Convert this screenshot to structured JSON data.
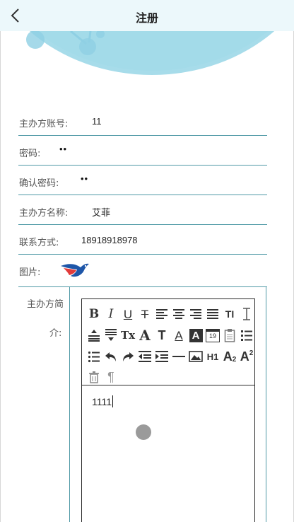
{
  "header": {
    "title": "注册",
    "back_icon": "chevron-left-icon"
  },
  "form": {
    "account": {
      "label": "主办方账号:",
      "value": "11"
    },
    "password": {
      "label": "密码:",
      "value": "••"
    },
    "confirm": {
      "label": "确认密码:",
      "value": "••"
    },
    "name": {
      "label": "主办方名称:",
      "value": "艾菲"
    },
    "contact": {
      "label": "联系方式:",
      "value": "18918918978"
    },
    "picture": {
      "label": "图片:"
    },
    "intro": {
      "label_line1": "主办方简",
      "label_line2": "介:",
      "content": "1111"
    }
  },
  "editor": {
    "toolbar": [
      {
        "name": "bold-icon",
        "glyph": "B"
      },
      {
        "name": "italic-icon",
        "glyph": "I"
      },
      {
        "name": "underline-icon",
        "glyph": "U"
      },
      {
        "name": "strikethrough-icon",
        "glyph": "T"
      },
      {
        "name": "align-left-icon",
        "glyph": ""
      },
      {
        "name": "align-center-icon",
        "glyph": ""
      },
      {
        "name": "align-right-icon",
        "glyph": ""
      },
      {
        "name": "align-justify-icon",
        "glyph": ""
      },
      {
        "name": "line-height-icon",
        "glyph": "TI"
      },
      {
        "name": "text-height-icon",
        "glyph": ""
      },
      {
        "name": "paragraph-spacing-top-icon",
        "glyph": ""
      },
      {
        "name": "paragraph-spacing-bottom-icon",
        "glyph": ""
      },
      {
        "name": "clear-format-icon",
        "glyph": "Tx"
      },
      {
        "name": "font-family-icon",
        "glyph": "A"
      },
      {
        "name": "font-size-icon",
        "glyph": "T"
      },
      {
        "name": "font-color-icon",
        "glyph": "A"
      },
      {
        "name": "background-color-icon",
        "glyph": "A"
      },
      {
        "name": "insert-date-icon",
        "glyph": "19"
      },
      {
        "name": "clipboard-icon",
        "glyph": ""
      },
      {
        "name": "ordered-list-icon",
        "glyph": ""
      },
      {
        "name": "unordered-list-icon",
        "glyph": ""
      },
      {
        "name": "undo-icon",
        "glyph": ""
      },
      {
        "name": "redo-icon",
        "glyph": ""
      },
      {
        "name": "outdent-icon",
        "glyph": ""
      },
      {
        "name": "indent-icon",
        "glyph": ""
      },
      {
        "name": "horizontal-rule-icon",
        "glyph": ""
      },
      {
        "name": "image-icon",
        "glyph": ""
      },
      {
        "name": "heading-icon",
        "glyph": "H1"
      },
      {
        "name": "subscript-icon",
        "glyph": "A"
      },
      {
        "name": "superscript-icon",
        "glyph": "A"
      },
      {
        "name": "delete-icon",
        "glyph": ""
      },
      {
        "name": "show-paragraph-icon",
        "glyph": "¶"
      }
    ]
  },
  "colors": {
    "accent": "#4f99a6",
    "header_bg": "#ecf8fb",
    "hero": "#a3dcea"
  }
}
